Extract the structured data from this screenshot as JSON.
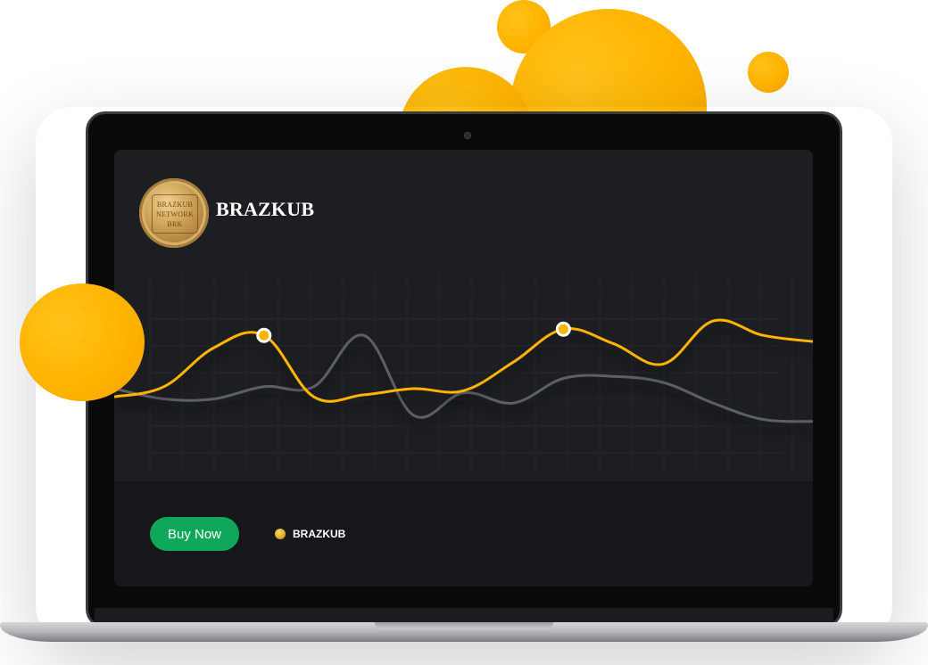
{
  "brand": {
    "title": "BRAZKUB",
    "coin_logo_text": [
      "BRAZKUB",
      "NETWORK",
      "BRK"
    ]
  },
  "actions": {
    "buy_label": "Buy Now"
  },
  "legend": {
    "label": "BRAZKUB"
  },
  "colors": {
    "accent": "#ffb400",
    "secondary_line": "#5b5f68",
    "button": "#0fa85a",
    "screen_bg": "#1d1e22"
  },
  "chart_data": {
    "type": "line",
    "title": "",
    "xlabel": "",
    "ylabel": "",
    "grid": true,
    "x": [
      0,
      1,
      2,
      3,
      4,
      5,
      6,
      7,
      8,
      9,
      10,
      11,
      12,
      13,
      14
    ],
    "ylim": [
      0,
      10
    ],
    "series": [
      {
        "name": "BRAZKUB",
        "color": "#ffb400",
        "values": [
          3.6,
          4.1,
          6.0,
          6.6,
          3.6,
          3.7,
          4.0,
          3.9,
          5.3,
          6.9,
          6.2,
          5.2,
          7.3,
          6.6,
          6.3
        ],
        "highlighted_x": [
          3,
          9
        ]
      },
      {
        "name": "",
        "color": "#5b5f68",
        "values": [
          4.0,
          3.5,
          3.5,
          4.1,
          4.1,
          6.6,
          2.7,
          3.8,
          3.3,
          4.5,
          4.6,
          4.3,
          3.3,
          2.5,
          2.4
        ]
      }
    ]
  }
}
